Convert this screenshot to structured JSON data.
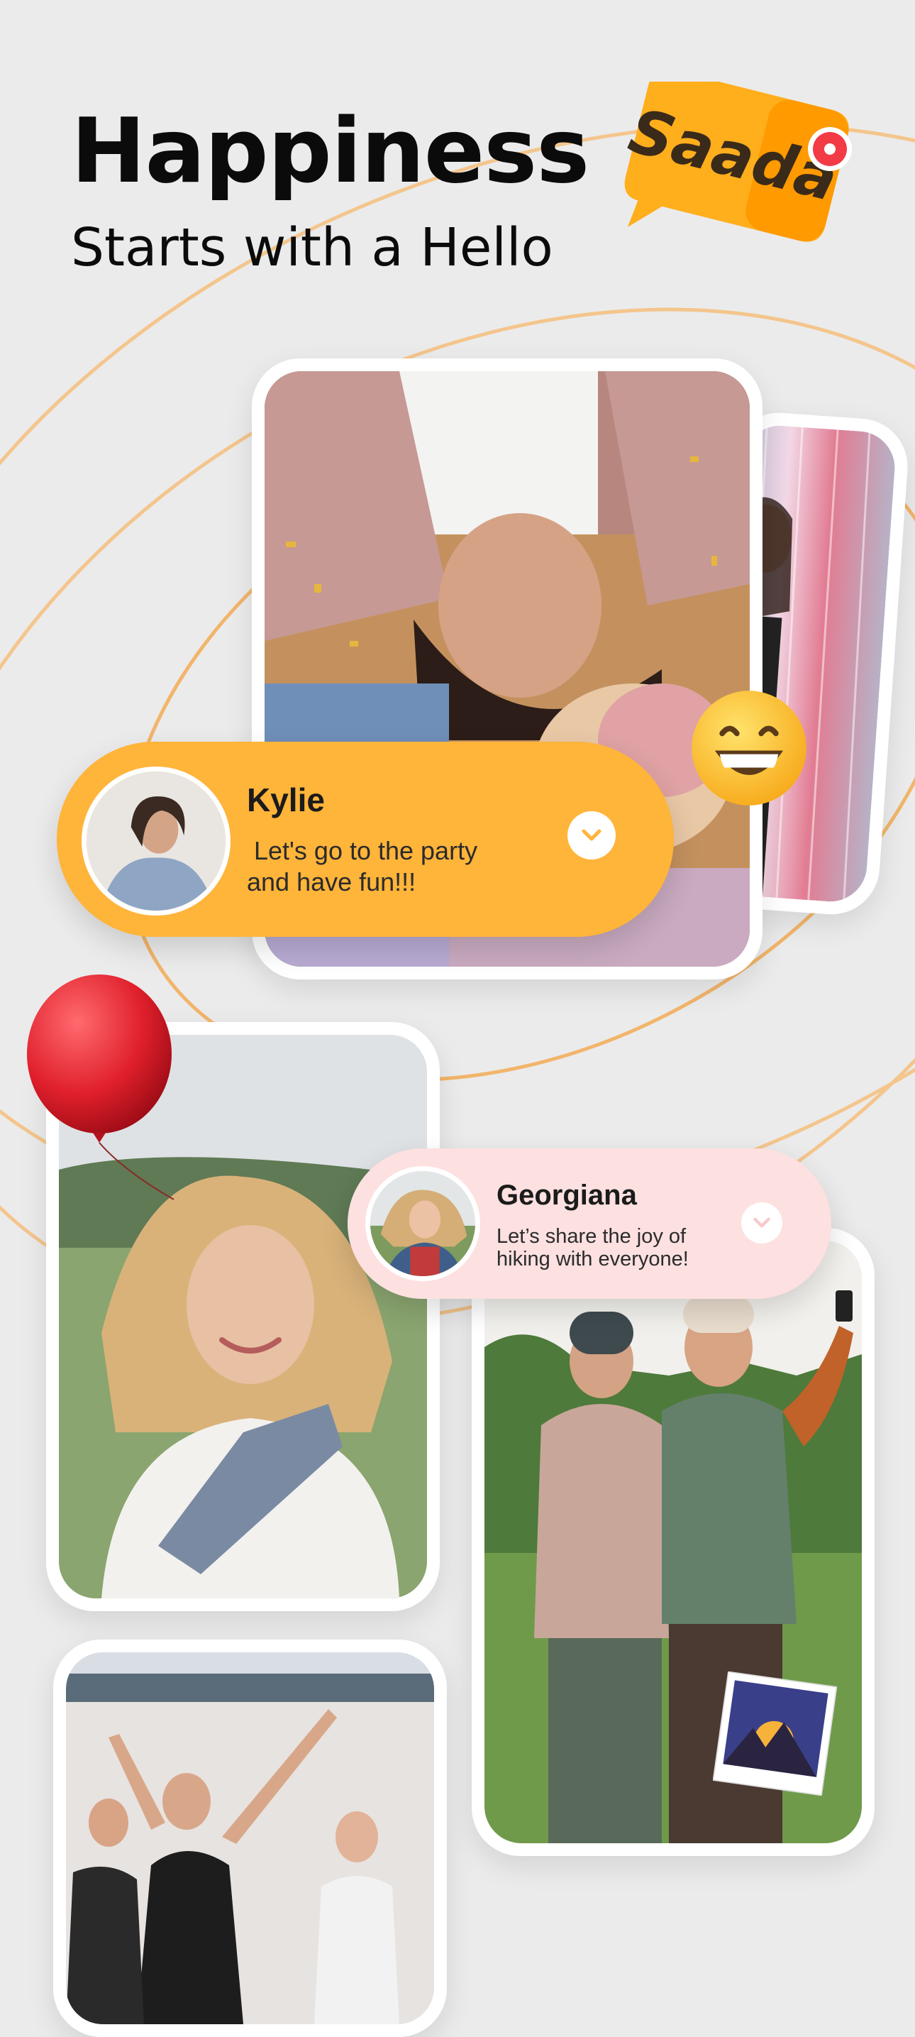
{
  "header": {
    "headline": "Happiness",
    "subhead": "Starts with a Hello"
  },
  "logo": {
    "text": "Saada",
    "color_primary": "#ffae1c",
    "color_secondary": "#ff9a00",
    "dot_color": "#f23b45"
  },
  "messages": [
    {
      "name": "Kylie",
      "text_line1": " Let's go to the party",
      "text_line2": "and have fun!!!",
      "bubble_color": "#ffb43a",
      "icon": "chevron-down-icon"
    },
    {
      "name": "Georgiana",
      "text_line1": "Let’s share the joy of",
      "text_line2": "hiking with everyone!",
      "bubble_color": "#fde0e0",
      "icon": "chevron-down-icon"
    }
  ],
  "stickers": {
    "emoji": "grinning-face-emoji",
    "balloon": "red-balloon-icon",
    "photo": "sunset-photo-icon"
  },
  "theme": {
    "background": "#ebebeb",
    "orbit_color": "#f4c58c"
  }
}
